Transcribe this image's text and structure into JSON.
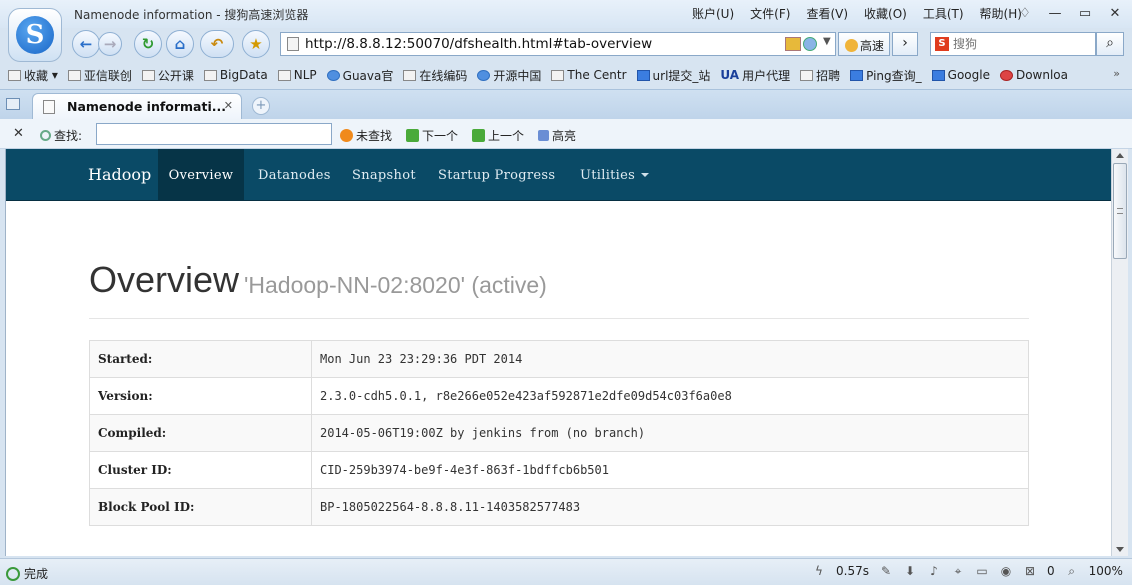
{
  "browser": {
    "window_title": "Namenode information - 搜狗高速浏览器",
    "menus": [
      "账户(U)",
      "文件(F)",
      "查看(V)",
      "收藏(O)",
      "工具(T)",
      "帮助(H)"
    ],
    "url": "http://8.8.8.12:50070/dfshealth.html#tab-overview",
    "speed_label": "高速",
    "search_placeholder": "搜狗",
    "bookmarks": [
      "收藏",
      "亚信联创",
      "公开课",
      "BigData",
      "NLP",
      "Guava官",
      "在线编码",
      "开源中国",
      "The Centr",
      "url提交_站",
      "用户代理",
      "招聘",
      "Ping查询_",
      "Google",
      "Downloa"
    ],
    "tab_label": "Namenode informati...",
    "find_label": "查找:",
    "find_value": "",
    "find_buttons": [
      "未查找",
      "下一个",
      "上一个",
      "高亮"
    ],
    "status_text": "完成",
    "load_time": "0.57s",
    "blocked_count": "0",
    "zoom": "100%"
  },
  "hadoop_nav": {
    "brand": "Hadoop",
    "items": [
      "Overview",
      "Datanodes",
      "Snapshot",
      "Startup Progress",
      "Utilities"
    ]
  },
  "overview": {
    "title": "Overview",
    "subtitle": "'Hadoop-NN-02:8020' (active)",
    "rows": [
      {
        "key": "Started:",
        "value": "Mon Jun 23 23:29:36 PDT 2014"
      },
      {
        "key": "Version:",
        "value": "2.3.0-cdh5.0.1, r8e266e052e423af592871e2dfe09d54c03f6a0e8"
      },
      {
        "key": "Compiled:",
        "value": "2014-05-06T19:00Z by jenkins from (no branch)"
      },
      {
        "key": "Cluster ID:",
        "value": "CID-259b3974-be9f-4e3f-863f-1bdffcb6b501"
      },
      {
        "key": "Block Pool ID:",
        "value": "BP-1805022564-8.8.8.11-1403582577483"
      }
    ]
  },
  "colors": {
    "navbar_bg": "#0a4a66",
    "navbar_active": "#063447"
  }
}
